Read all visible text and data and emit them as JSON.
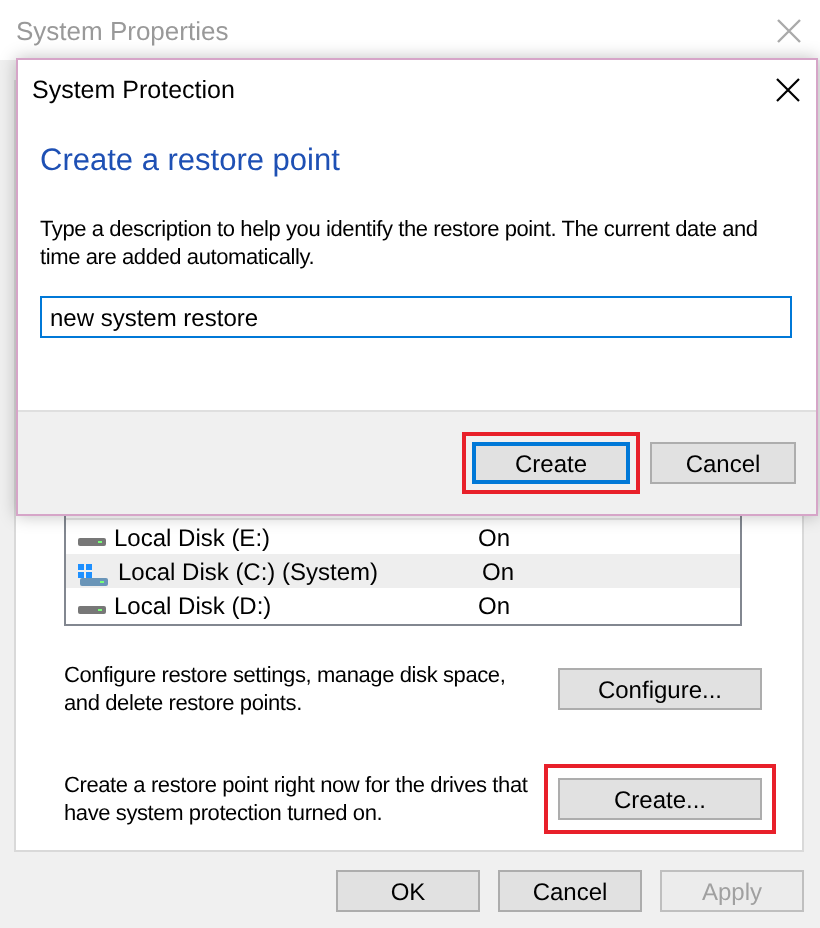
{
  "window": {
    "title": "System Properties"
  },
  "drives": [
    {
      "name": "Local Disk (E:)",
      "protection": "On",
      "system": false,
      "selected": false
    },
    {
      "name": "Local Disk (C:) (System)",
      "protection": "On",
      "system": true,
      "selected": true
    },
    {
      "name": "Local Disk (D:)",
      "protection": "On",
      "system": false,
      "selected": false
    }
  ],
  "configure": {
    "text": "Configure restore settings, manage disk space, and delete restore points.",
    "button": "Configure...",
    "highlighted": false
  },
  "create": {
    "text": "Create a restore point right now for the drives that have system protection turned on.",
    "button": "Create...",
    "highlighted": true
  },
  "buttons": [
    {
      "label": "OK",
      "disabled": false
    },
    {
      "label": "Cancel",
      "disabled": false
    },
    {
      "label": "Apply",
      "disabled": true
    }
  ],
  "dialog": {
    "title": "System Protection",
    "heading": "Create a restore point",
    "description": "Type a description to help you identify the restore point. The current date and time are added automatically.",
    "value": "new system restore",
    "buttons": [
      {
        "label": "Create",
        "default": true,
        "highlighted": true
      },
      {
        "label": "Cancel",
        "default": false,
        "highlighted": false
      }
    ]
  }
}
